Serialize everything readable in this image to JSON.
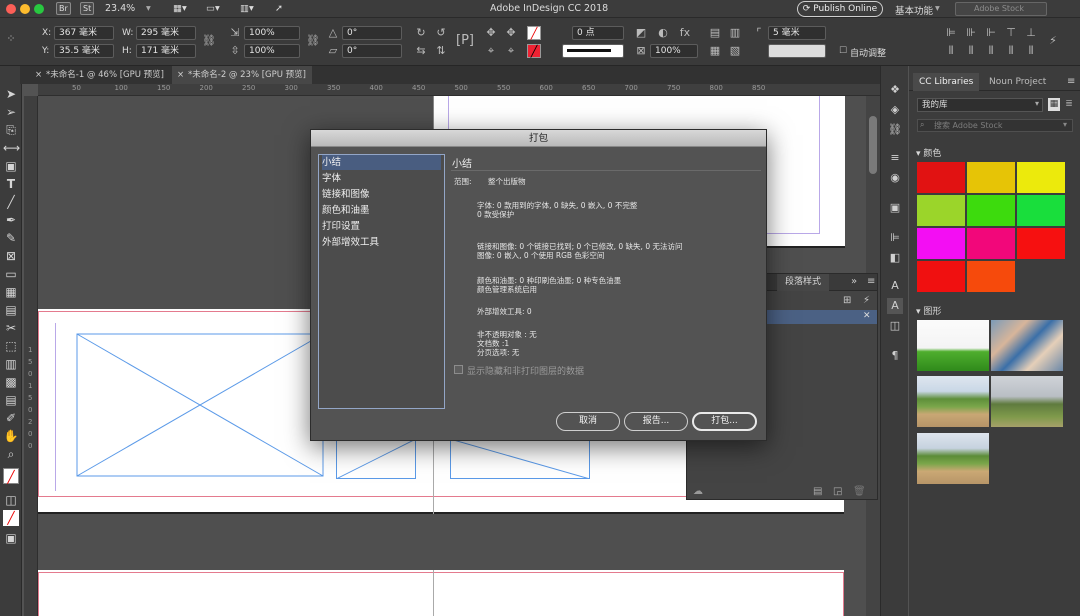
{
  "titlebar": {
    "app_icon_1": "Br",
    "app_icon_2": "St",
    "zoom": "23.4%",
    "title": "Adobe InDesign CC 2018",
    "publish": "Publish Online",
    "workspace": "基本功能",
    "search_placeholder": "Adobe Stock"
  },
  "controlbar": {
    "x_label": "X:",
    "x_value": "367 毫米",
    "y_label": "Y:",
    "y_value": "35.5 毫米",
    "w_label": "W:",
    "w_value": "295 毫米",
    "h_label": "H:",
    "h_value": "171 毫米",
    "scale_x": "100%",
    "scale_y": "100%",
    "rotate": "0°",
    "shear": "0°",
    "stroke_weight": "0 点",
    "opacity": "100%",
    "corner": "5 毫米",
    "auto_fit": "自动调整"
  },
  "tabs": [
    {
      "label": "*未命名-1 @ 46% [GPU 预览]"
    },
    {
      "label": "*未命名-2 @ 23% [GPU 预览]"
    }
  ],
  "ruler": {
    "h_ticks": [
      "50",
      "100",
      "150",
      "200",
      "250",
      "300",
      "350",
      "400",
      "450",
      "500",
      "550",
      "600",
      "650",
      "700",
      "750",
      "800",
      "850"
    ],
    "v_ticks": [
      "1",
      "5",
      "0",
      "1",
      "5",
      "0",
      "2",
      "0",
      "0"
    ]
  },
  "libraries": {
    "tab_cc": "CC Libraries",
    "tab_noun": "Noun Project",
    "library": "我的库",
    "search_placeholder": "搜索 Adobe Stock",
    "colors_title": "颜色",
    "graphics_title": "图形",
    "swatches": [
      "#e11212",
      "#e6c406",
      "#ecea0c",
      "#9bd52a",
      "#3ddb0d",
      "#19de3c",
      "#f30ef3",
      "#f2077a",
      "#f61010",
      "#f01010",
      "#f64a0c"
    ]
  },
  "para_panel": {
    "tab": "段落样式"
  },
  "dialog": {
    "title": "打包",
    "sections": [
      "小结",
      "字体",
      "链接和图像",
      "颜色和油墨",
      "打印设置",
      "外部增效工具"
    ],
    "heading": "小结",
    "scope_label": "范围:",
    "scope_value": "整个出版物",
    "fonts_line1": "字体: 0 款用到的字体, 0 缺失, 0 嵌入, 0 不完整",
    "fonts_line2": "0 款受保护",
    "links_line1": "链接和图像: 0 个链接已找到; 0 个已修改, 0 缺失, 0 无法访问",
    "links_line2": "图像: 0 嵌入, 0 个使用 RGB 色彩空间",
    "inks_line1": "颜色和油墨: 0 种印刷色油墨; 0 种专色油墨",
    "inks_line2": "颜色管理系统启用",
    "plugins_line": "外部增效工具: 0",
    "misc_line1": "非不透明对象 : 无",
    "misc_line2": "文档数 :1",
    "misc_line3": "分页选项: 无",
    "show_hidden": "显示隐藏和非打印图层的数据",
    "cancel": "取消",
    "report": "报告...",
    "package": "打包..."
  }
}
